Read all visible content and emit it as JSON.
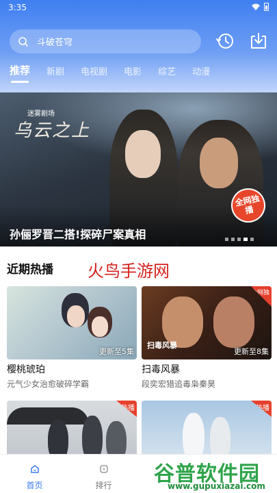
{
  "status": {
    "time": "3:35"
  },
  "search": {
    "placeholder": "斗破苍穹"
  },
  "tabs": [
    "推荐",
    "新剧",
    "电视剧",
    "电影",
    "综艺",
    "动漫"
  ],
  "banner": {
    "brand": "迷雾剧场",
    "show_title_art": "乌云之上",
    "stamp": "全网独播",
    "caption": "孙俪罗晋二搭!探碎尸案真相",
    "page_count": 5,
    "active_page": 4
  },
  "section": {
    "title": "近期热播",
    "watermark": "火鸟手游网"
  },
  "cards": [
    {
      "title": "樱桃琥珀",
      "desc": "元气少女治愈破碎学霸",
      "update": "更新至5集",
      "tag": ""
    },
    {
      "title": "扫毒风暴",
      "desc": "段奕宏猎追毒枭秦昊",
      "update": "更新至8集",
      "tag": "全网独播",
      "art_text": "扫毒风暴"
    },
    {
      "title": "",
      "desc": "",
      "update": "",
      "tag": "热播"
    },
    {
      "title": "",
      "desc": "",
      "update": "",
      "tag": "热播"
    }
  ],
  "nav": [
    {
      "label": "首页",
      "icon": "home-icon",
      "active": true
    },
    {
      "label": "排行",
      "icon": "ranking-icon",
      "active": false
    }
  ],
  "site_watermark": {
    "name": "谷普软件园",
    "url": "www.gupuxiazai.com"
  },
  "colors": {
    "accent": "#3b7cf0",
    "hot": "#e5402c",
    "watermark_red": "#d6231f"
  }
}
